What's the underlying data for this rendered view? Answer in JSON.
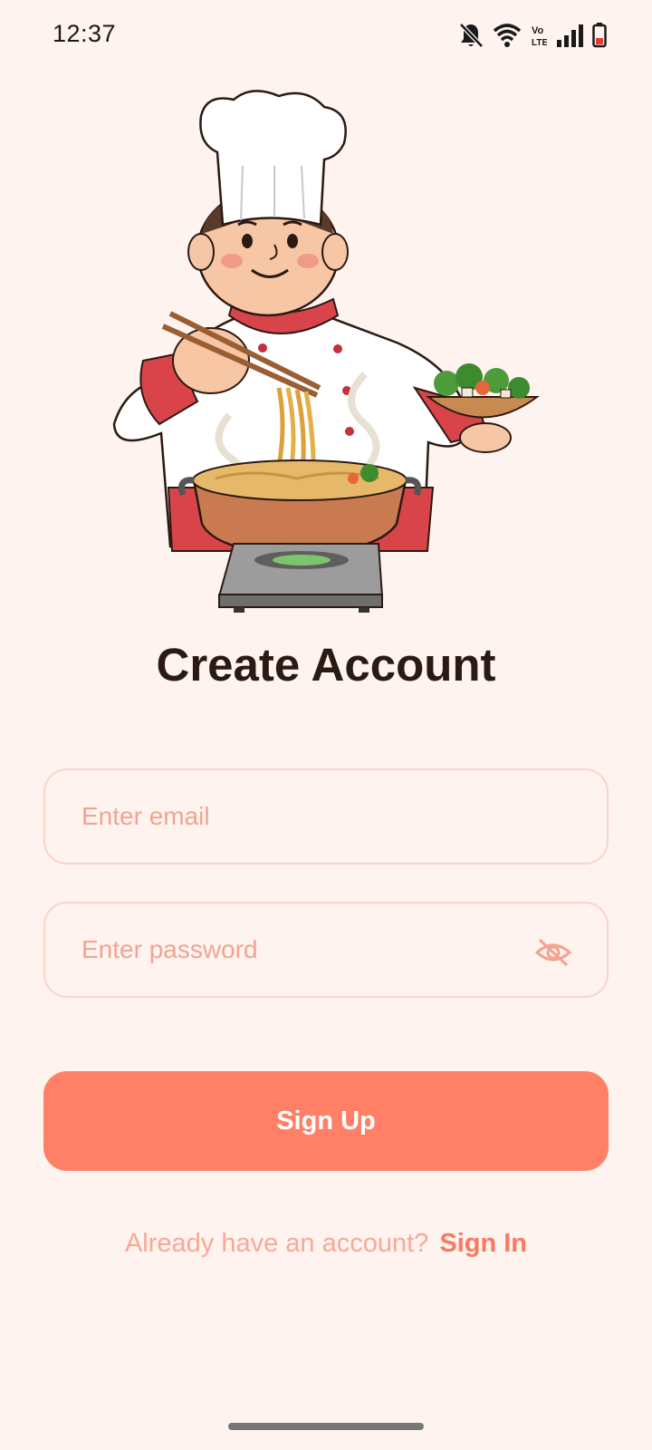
{
  "status_bar": {
    "time": "12:37",
    "icons": [
      "notifications-off-icon",
      "wifi-icon",
      "volte-icon",
      "signal-icon",
      "battery-low-icon"
    ],
    "volte_text": "Vo LTE"
  },
  "illustration": {
    "name": "chef-cooking-noodles-illustration"
  },
  "title": "Create Account",
  "email": {
    "placeholder": "Enter email",
    "value": ""
  },
  "password": {
    "placeholder": "Enter password",
    "value": "",
    "visibility_icon": "eye-off-icon"
  },
  "signup_button": {
    "label": "Sign Up"
  },
  "signin": {
    "prompt": "Already have an account?",
    "link_label": "Sign In"
  },
  "colors": {
    "background": "#FEF3EF",
    "accent": "#FF8066",
    "field_border": "#F9D4C9",
    "placeholder": "#F2A490",
    "title": "#2B1A14"
  }
}
